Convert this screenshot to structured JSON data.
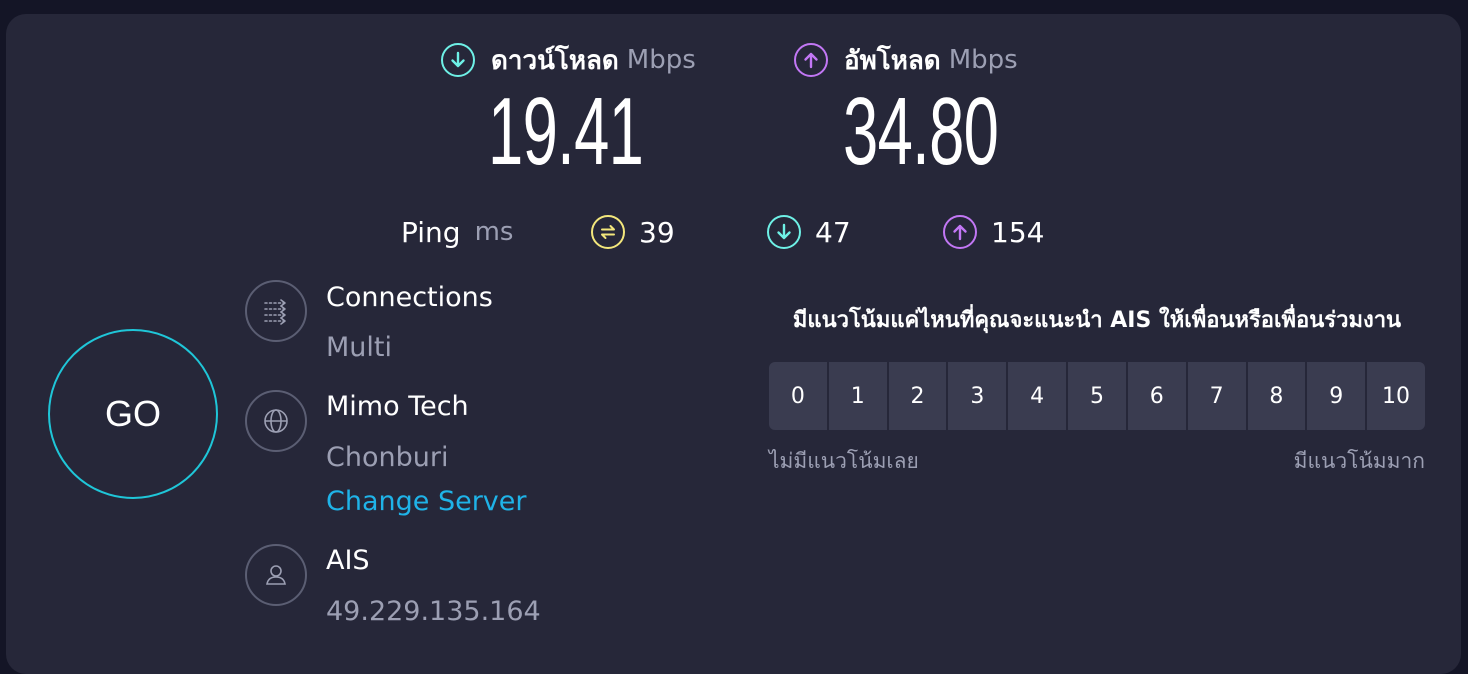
{
  "download": {
    "label": "ดาวน์โหลด",
    "unit": "Mbps",
    "value": "19.41",
    "icon": "download-arrow-icon",
    "color": "#6ef0e6"
  },
  "upload": {
    "label": "อัพโหลด",
    "unit": "Mbps",
    "value": "34.80",
    "icon": "upload-arrow-icon",
    "color": "#c277f5"
  },
  "ping": {
    "label": "Ping",
    "unit": "ms",
    "idle": {
      "value": "39",
      "icon": "ping-jitter-icon",
      "color": "#f3e77c"
    },
    "download": {
      "value": "47",
      "icon": "download-arrow-icon",
      "color": "#6ef0e6"
    },
    "upload": {
      "value": "154",
      "icon": "upload-arrow-icon",
      "color": "#c277f5"
    }
  },
  "go_button": {
    "label": "GO",
    "ring_color": "#1fc6d8"
  },
  "connections": {
    "title": "Connections",
    "value": "Multi",
    "icon": "connections-icon"
  },
  "server": {
    "name": "Mimo Tech",
    "location": "Chonburi",
    "change_label": "Change Server",
    "icon": "globe-icon"
  },
  "provider": {
    "name": "AIS",
    "ip": "49.229.135.164",
    "icon": "user-icon"
  },
  "survey": {
    "question": "มีแนวโน้มแค่ไหนที่คุณจะแนะนำ AIS ให้เพื่อนหรือเพื่อนร่วมงาน",
    "options": [
      "0",
      "1",
      "2",
      "3",
      "4",
      "5",
      "6",
      "7",
      "8",
      "9",
      "10"
    ],
    "low_label": "ไม่มีแนวโน้มเลย",
    "high_label": "มีแนวโน้มมาก"
  },
  "colors": {
    "background": "#141526",
    "card": "#262739",
    "accent_link": "#1fb3e8",
    "muted_text": "#9c9fb3"
  }
}
